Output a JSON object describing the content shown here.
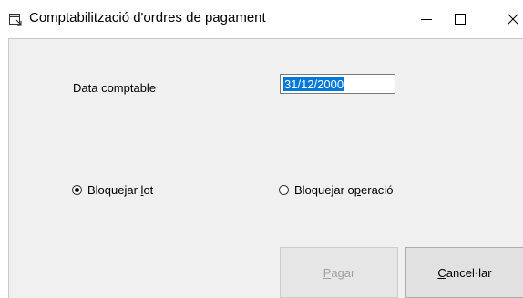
{
  "window": {
    "title": "Comptabilització d'ordres de pagament",
    "icon": "document-window-icon"
  },
  "controls": {
    "minimize": "minimize-icon",
    "maximize": "maximize-icon",
    "close": "close-icon"
  },
  "form": {
    "date_label": "Data comptable",
    "date_value": "31/12/2000",
    "radio_lot": {
      "before": "Bloquejar ",
      "underlined": "l",
      "after": "ot",
      "selected": true
    },
    "radio_op": {
      "before": "Bloquejar o",
      "underlined": "p",
      "after": "eració",
      "selected": false
    }
  },
  "buttons": {
    "pay": {
      "underlined": "P",
      "rest": "agar",
      "enabled": false
    },
    "cancel": {
      "underlined": "C",
      "rest": "ancel·lar",
      "enabled": true
    }
  }
}
